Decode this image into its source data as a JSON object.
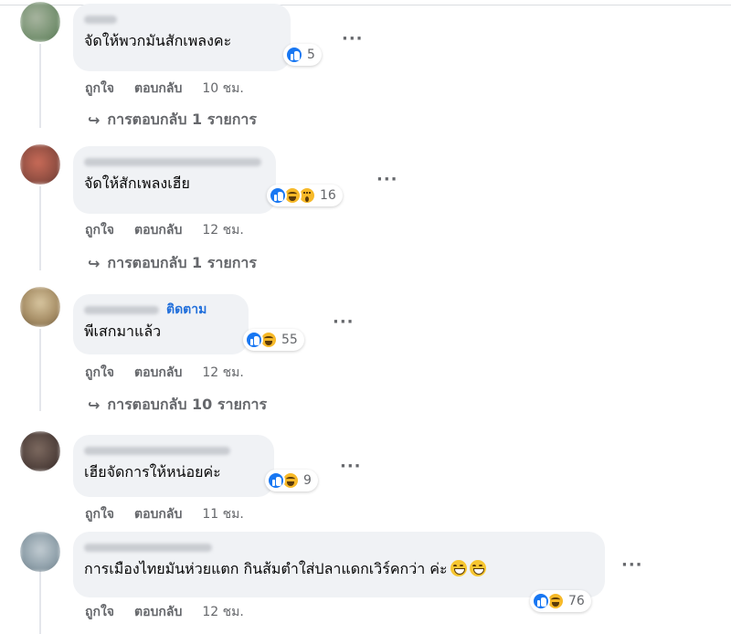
{
  "comments": [
    {
      "text": "จัดให้พวกมันสักเพลงคะ",
      "reaction_count": "5",
      "reactions": [
        "like"
      ],
      "like_label": "ถูกใจ",
      "reply_label": "ตอบกลับ",
      "time": "10 ชม.",
      "replies": "การตอบกลับ 1 รายการ",
      "avatar_colors": [
        "#8a9a85",
        "#6f8c6a"
      ]
    },
    {
      "text": "จัดให้สักเพลงเฮีย",
      "reaction_count": "16",
      "reactions": [
        "like",
        "haha",
        "wow"
      ],
      "like_label": "ถูกใจ",
      "reply_label": "ตอบกลับ",
      "time": "12 ชม.",
      "replies": "การตอบกลับ 1 รายการ",
      "avatar_colors": [
        "#b45a4a",
        "#7d4a3e"
      ]
    },
    {
      "follow": "ติดตาม",
      "text": "พีเสกมาแล้ว",
      "reaction_count": "55",
      "reactions": [
        "like",
        "haha"
      ],
      "like_label": "ถูกใจ",
      "reply_label": "ตอบกลับ",
      "time": "12 ชม.",
      "replies": "การตอบกลับ 10 รายการ",
      "avatar_colors": [
        "#c8b48c",
        "#8c7a5a"
      ]
    },
    {
      "text": "เฮียจัดการให้หน่อยค่ะ",
      "reaction_count": "9",
      "reactions": [
        "like",
        "haha"
      ],
      "like_label": "ถูกใจ",
      "reply_label": "ตอบกลับ",
      "time": "11 ชม.",
      "avatar_colors": [
        "#6b5a52",
        "#4a3a34"
      ]
    },
    {
      "text": "การเมืองไทยมันห่วยแตก กินส้มตำใส่ปลาแดกเวิร์คกว่า ค่ะ",
      "reaction_count": "76",
      "reactions": [
        "like",
        "haha"
      ],
      "like_label": "ถูกใจ",
      "reply_label": "ตอบกลับ",
      "time": "12 ชม.",
      "avatar_colors": [
        "#9aa8b2",
        "#7a8a92"
      ]
    }
  ],
  "more_glyph": "···",
  "reply_arrow": "↪",
  "colors": {
    "bubble": "#f0f2f5",
    "secondary_text": "#65676b",
    "follow_link": "#216fdb",
    "like_blue": "#1877f2",
    "haha_yellow": "#f7b928"
  }
}
